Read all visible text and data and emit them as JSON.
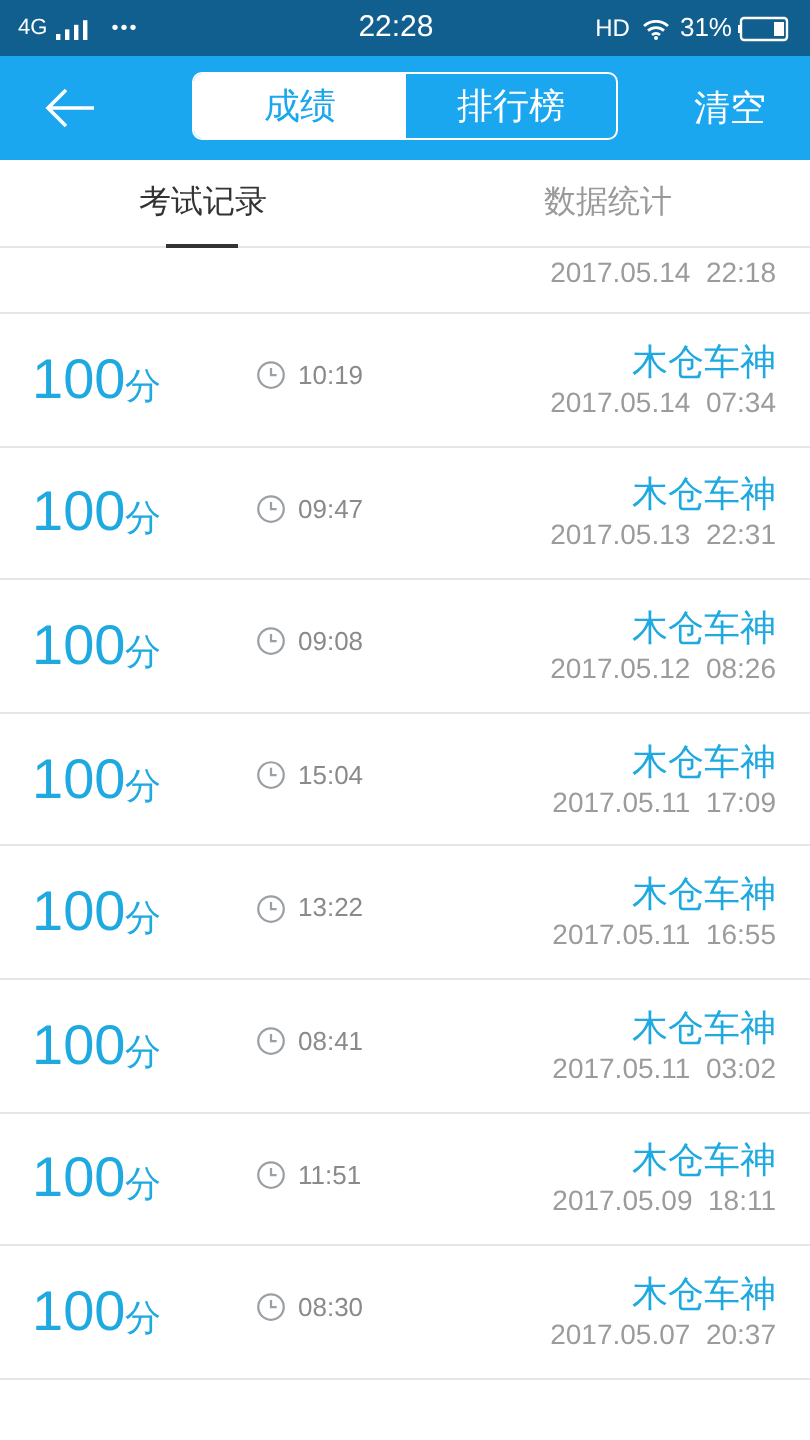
{
  "status_bar": {
    "network": "4G",
    "dots": "•••",
    "time": "22:28",
    "hd": "HD",
    "battery": "31%"
  },
  "header": {
    "segments": [
      {
        "label": "成绩",
        "selected": true
      },
      {
        "label": "排行榜",
        "selected": false
      }
    ],
    "action": "清空"
  },
  "tabs": [
    {
      "label": "考试记录",
      "selected": true
    },
    {
      "label": "数据统计",
      "selected": false
    }
  ],
  "records": [
    {
      "kind": "date_only",
      "date": "2017.05.14  22:18"
    },
    {
      "kind": "full",
      "score": "100",
      "unit": "分",
      "duration": "10:19",
      "name": "木仓车神",
      "date": "2017.05.14  07:34"
    },
    {
      "kind": "full",
      "score": "100",
      "unit": "分",
      "duration": "09:47",
      "name": "木仓车神",
      "date": "2017.05.13  22:31"
    },
    {
      "kind": "full",
      "score": "100",
      "unit": "分",
      "duration": "09:08",
      "name": "木仓车神",
      "date": "2017.05.12  08:26"
    },
    {
      "kind": "full",
      "score": "100",
      "unit": "分",
      "duration": "15:04",
      "name": "木仓车神",
      "date": "2017.05.11  17:09"
    },
    {
      "kind": "full",
      "score": "100",
      "unit": "分",
      "duration": "13:22",
      "name": "木仓车神",
      "date": "2017.05.11  16:55"
    },
    {
      "kind": "full",
      "score": "100",
      "unit": "分",
      "duration": "08:41",
      "name": "木仓车神",
      "date": "2017.05.11  03:02"
    },
    {
      "kind": "full",
      "score": "100",
      "unit": "分",
      "duration": "11:51",
      "name": "木仓车神",
      "date": "2017.05.09  18:11"
    },
    {
      "kind": "full",
      "score": "100",
      "unit": "分",
      "duration": "08:30",
      "name": "木仓车神",
      "date": "2017.05.07  20:37"
    }
  ]
}
